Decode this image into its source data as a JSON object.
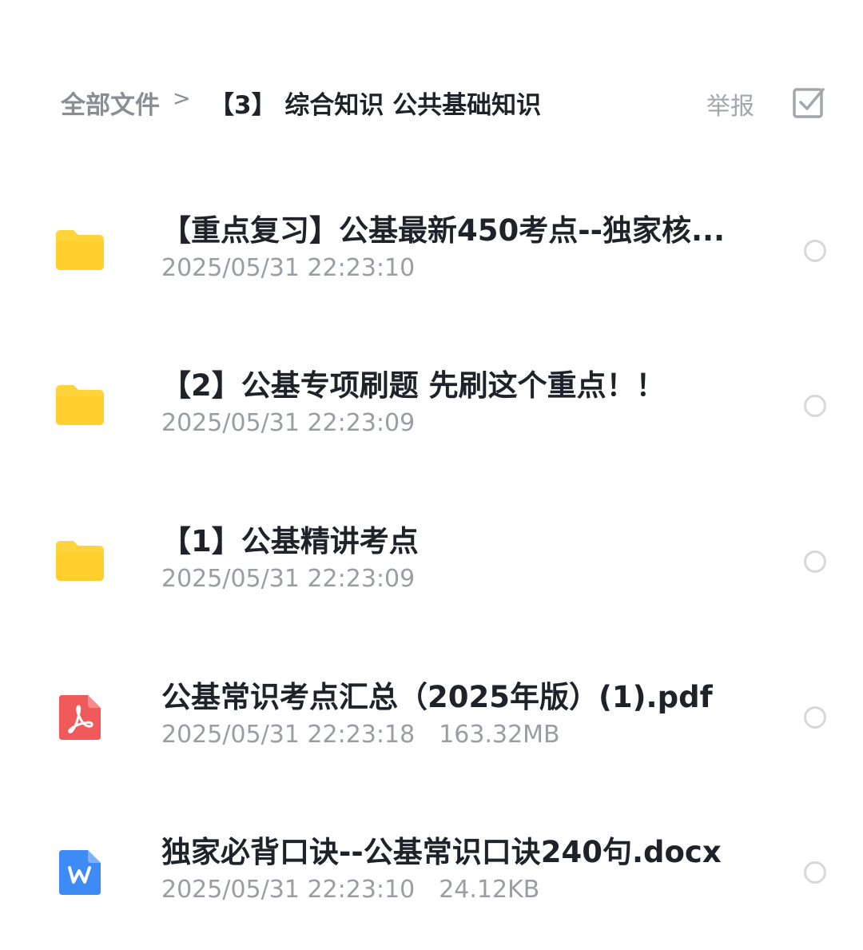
{
  "header": {
    "root_label": "全部文件",
    "separator": ">",
    "current_folder": "【3】 综合知识 公共基础知识",
    "report_label": "举报",
    "select_icon": "checkbox-icon"
  },
  "files": [
    {
      "type": "folder",
      "icon": "folder-icon",
      "name": "【重点复习】公基最新450考点--独家核...",
      "datetime": "2025/05/31 22:23:10",
      "size": ""
    },
    {
      "type": "folder",
      "icon": "folder-icon",
      "name": "【2】公基专项刷题 先刷这个重点！！",
      "datetime": "2025/05/31 22:23:09",
      "size": ""
    },
    {
      "type": "folder",
      "icon": "folder-icon",
      "name": "【1】公基精讲考点",
      "datetime": "2025/05/31 22:23:09",
      "size": ""
    },
    {
      "type": "pdf",
      "icon": "pdf-icon",
      "name": "公基常识考点汇总（2025年版）(1).pdf",
      "datetime": "2025/05/31 22:23:18",
      "size": "163.32MB"
    },
    {
      "type": "docx",
      "icon": "word-icon",
      "name": "独家必背口诀--公基常识口诀240句.docx",
      "datetime": "2025/05/31 22:23:10",
      "size": "24.12KB"
    }
  ],
  "colors": {
    "folder": "#FFD43B",
    "pdf": "#F05A5A",
    "word": "#3E8BF5",
    "title": "#1F2329",
    "meta": "#9A9DA3"
  }
}
